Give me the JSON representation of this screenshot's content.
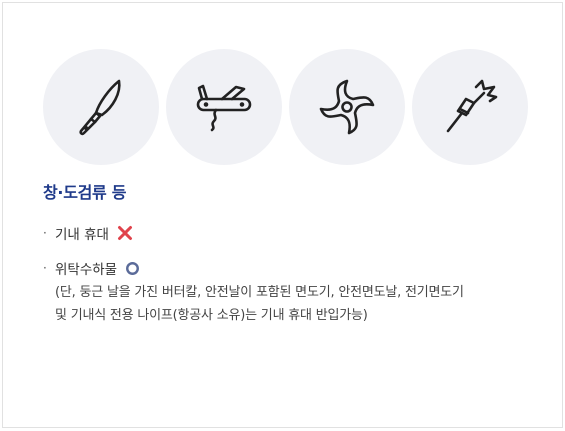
{
  "icons": [
    {
      "name": "knife-icon"
    },
    {
      "name": "swiss-army-knife-icon"
    },
    {
      "name": "shuriken-icon"
    },
    {
      "name": "dart-icon"
    }
  ],
  "section": {
    "title": "창·도검류 등"
  },
  "items": [
    {
      "bullet": "·",
      "label": "기내 휴대",
      "status": "x-mark-icon",
      "status_color": "#e0434c"
    },
    {
      "bullet": "·",
      "label": "위탁수하물",
      "status": "o-mark-icon",
      "status_color": "#5b6b99"
    }
  ],
  "note_lines": [
    "(단, 둥근 날을 가진 버터칼, 안전날이 포함된 면도기, 안전면도날, 전기면도기",
    "및 기내식 전용 나이프(항공사 소유)는 기내 휴대 반입가능)"
  ]
}
